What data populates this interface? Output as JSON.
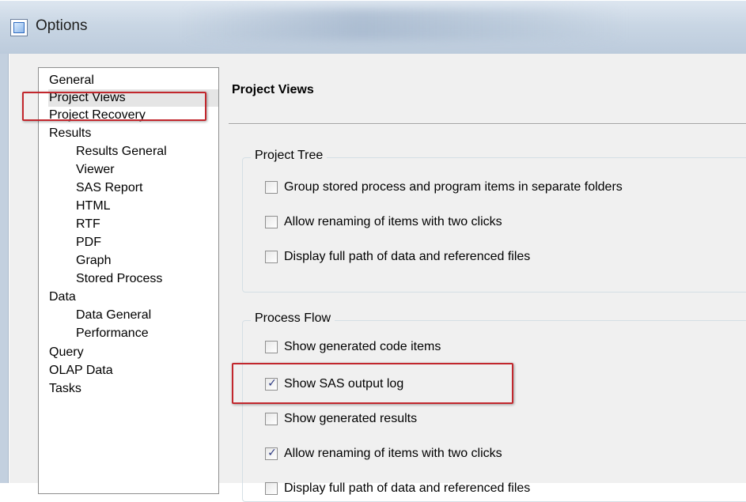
{
  "window": {
    "title": "Options"
  },
  "nav": {
    "items": [
      {
        "label": "General",
        "level": 0
      },
      {
        "label": "Project Views",
        "level": 0,
        "selected": true
      },
      {
        "label": "Project Recovery",
        "level": 0
      },
      {
        "label": "Results",
        "level": 0
      },
      {
        "label": "Results General",
        "level": 1
      },
      {
        "label": "Viewer",
        "level": 1
      },
      {
        "label": "SAS Report",
        "level": 1
      },
      {
        "label": "HTML",
        "level": 1
      },
      {
        "label": "RTF",
        "level": 1
      },
      {
        "label": "PDF",
        "level": 1
      },
      {
        "label": "Graph",
        "level": 1
      },
      {
        "label": "Stored Process",
        "level": 1
      },
      {
        "label": "Data",
        "level": 0
      },
      {
        "label": "Data General",
        "level": 1
      },
      {
        "label": "Performance",
        "level": 1
      },
      {
        "label": "Query",
        "level": 0
      },
      {
        "label": "OLAP Data",
        "level": 0
      },
      {
        "label": "Tasks",
        "level": 0
      }
    ]
  },
  "page": {
    "title": "Project Views"
  },
  "project_tree": {
    "title": "Project Tree",
    "options": [
      {
        "label": "Group stored process and program items in separate folders",
        "checked": false
      },
      {
        "label": "Allow renaming of items with two clicks",
        "checked": false
      },
      {
        "label": "Display full path of data and referenced files",
        "checked": false
      }
    ]
  },
  "process_flow": {
    "title": "Process Flow",
    "options": [
      {
        "label": "Show generated code items",
        "checked": false
      },
      {
        "label": "Show SAS output log",
        "checked": true
      },
      {
        "label": "Show generated results",
        "checked": false
      },
      {
        "label": "Allow renaming of items with two clicks",
        "checked": true
      },
      {
        "label": "Display full path of data and referenced files",
        "checked": false
      }
    ]
  },
  "colors": {
    "highlight_box": "#c2272d",
    "selection": "#e5e5e5"
  }
}
